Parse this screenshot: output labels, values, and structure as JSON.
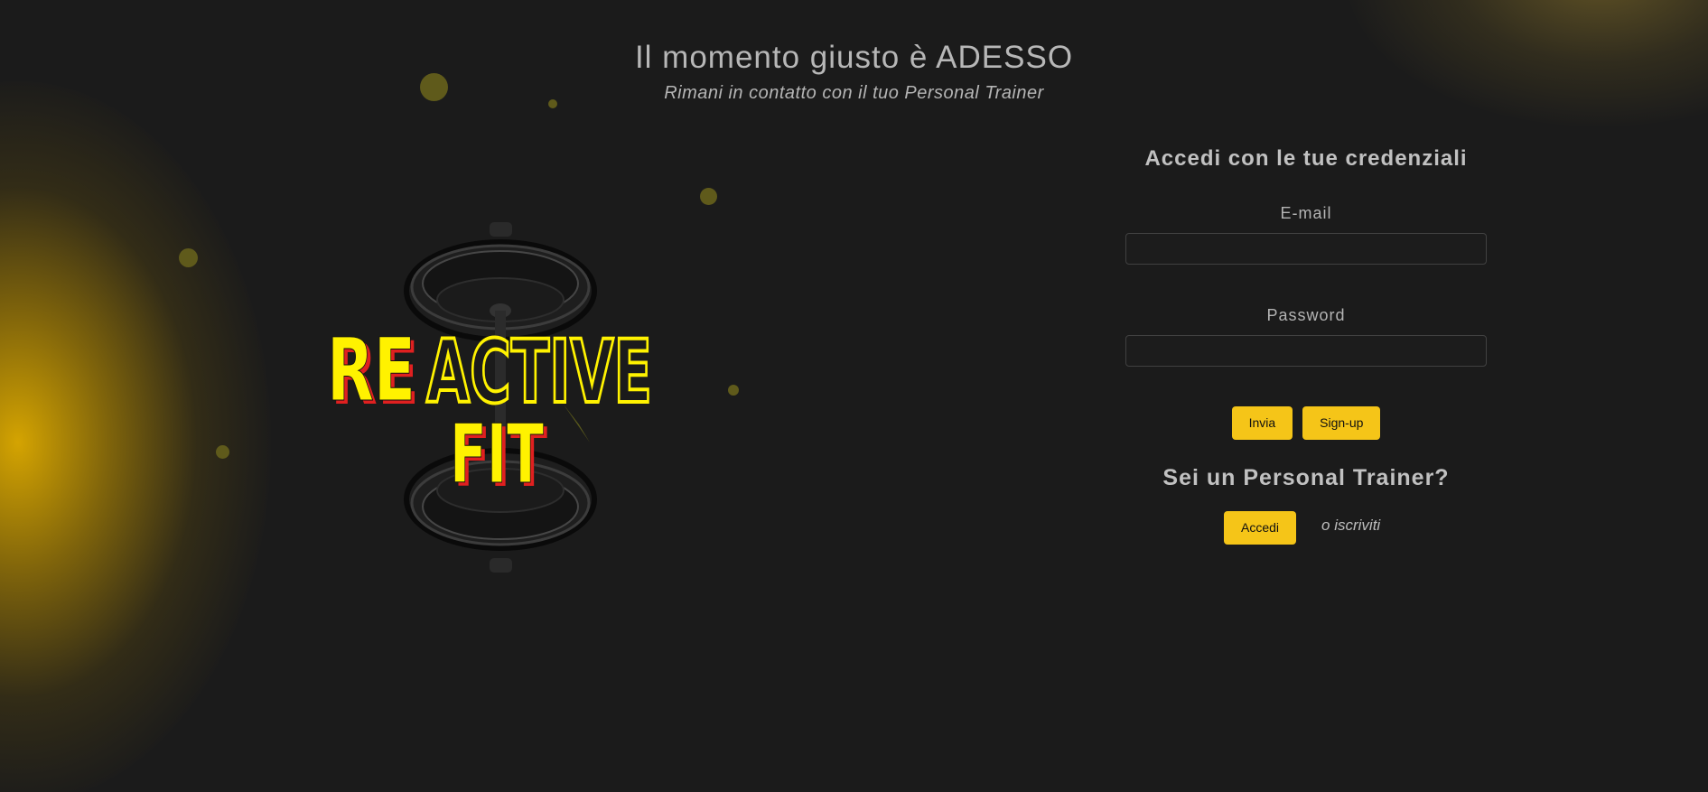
{
  "header": {
    "title": "Il momento giusto è ADESSO",
    "subtitle": "Rimani in contatto con il tuo Personal Trainer"
  },
  "logo": {
    "text_re": "RE",
    "text_active": "ACTIVE",
    "text_fit": "FIT"
  },
  "login": {
    "heading": "Accedi con le tue credenziali",
    "email_label": "E-mail",
    "email_value": "",
    "password_label": "Password",
    "password_value": "",
    "submit_label": "Invia",
    "signup_label": "Sign-up"
  },
  "trainer": {
    "heading": "Sei un Personal Trainer?",
    "login_label": "Accedi",
    "signup_link": "o iscriviti"
  },
  "colors": {
    "background": "#1b1b1b",
    "accent": "#f5c518",
    "logo_yellow": "#fff200",
    "logo_red": "#e02020",
    "text": "#b7b7b7"
  }
}
